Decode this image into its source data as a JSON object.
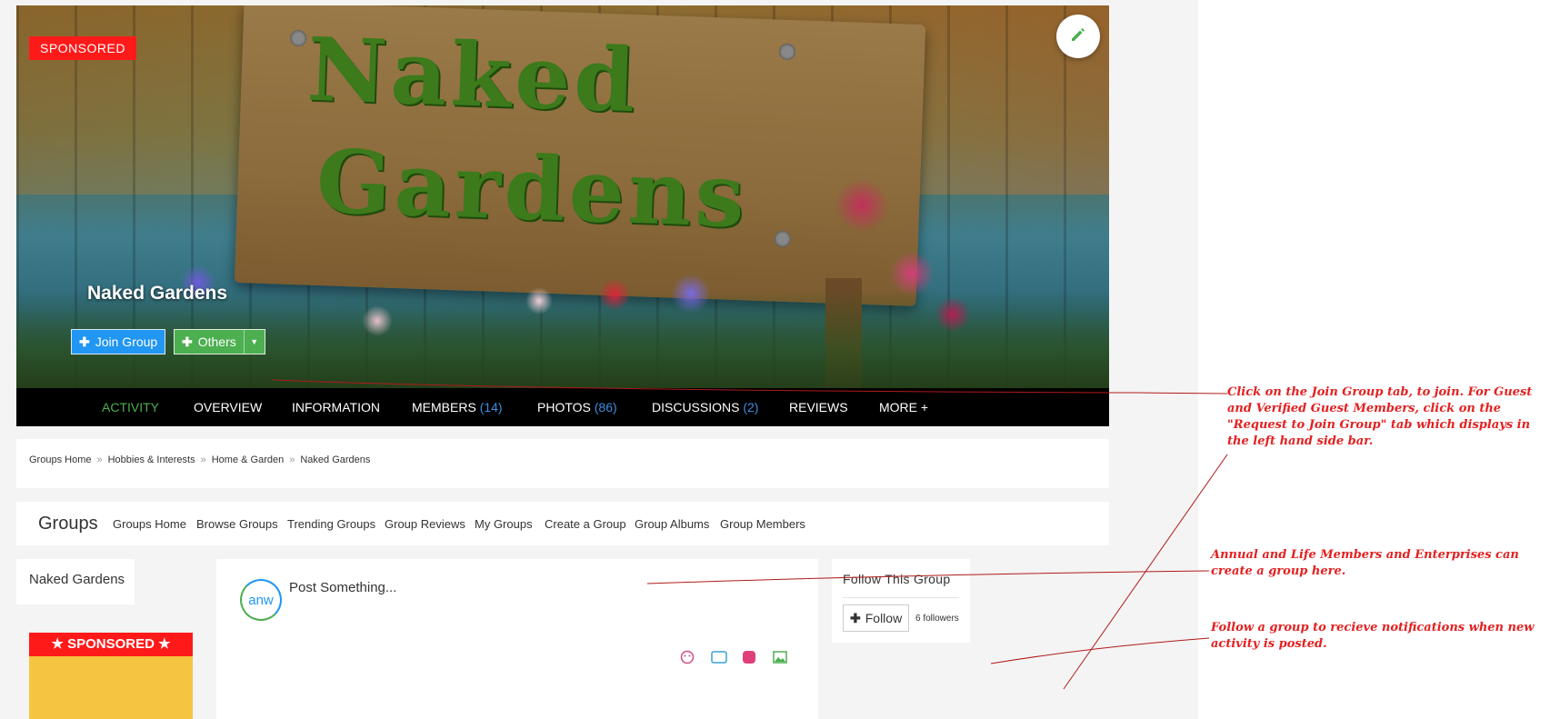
{
  "cover": {
    "badge": "SPONSORED",
    "group_name": "Naked Gardens",
    "sign_line_1": "Naked",
    "sign_line_2": "Gardens",
    "join_label": "Join Group",
    "others_label": "Others",
    "tabs": [
      {
        "label": "ACTIVITY",
        "count": ""
      },
      {
        "label": "OVERVIEW",
        "count": ""
      },
      {
        "label": "INFORMATION",
        "count": ""
      },
      {
        "label": "MEMBERS",
        "count": "(14)"
      },
      {
        "label": "PHOTOS",
        "count": "(86)"
      },
      {
        "label": "DISCUSSIONS",
        "count": "(2)"
      },
      {
        "label": "REVIEWS",
        "count": ""
      },
      {
        "label": "MORE +",
        "count": ""
      }
    ]
  },
  "breadcrumb": [
    "Groups Home",
    "Hobbies & Interests",
    "Home & Garden",
    "Naked Gardens"
  ],
  "breadcrumb_sep": "»",
  "groups_nav": {
    "title": "Groups",
    "items": [
      "Groups Home",
      "Browse Groups",
      "Trending Groups",
      "Group Reviews",
      "My Groups",
      "Create a Group",
      "Group Albums",
      "Group Members"
    ]
  },
  "sidebar": {
    "group_name": "Naked Gardens",
    "sponsored_label": "SPONSORED"
  },
  "post": {
    "avatar_text": "anw",
    "prompt": "Post Something..."
  },
  "follow": {
    "title": "Follow This Group",
    "button": "Follow",
    "followers": "6 followers"
  },
  "annotations": {
    "join": "Click on the Join Group tab, to join. For Guest and Verified Guest Members, click on the \"Request to Join Group\" tab which displays in the left hand side bar.",
    "create": "Annual and Life Members and Enterprises can create a group here.",
    "follow": "Follow a group to recieve notifications when new activity is posted."
  },
  "colors": {
    "accent_blue": "#2196f3",
    "accent_green": "#4caf50",
    "sponsored_red": "#ff1a1a",
    "annotation_red": "#e32020"
  }
}
